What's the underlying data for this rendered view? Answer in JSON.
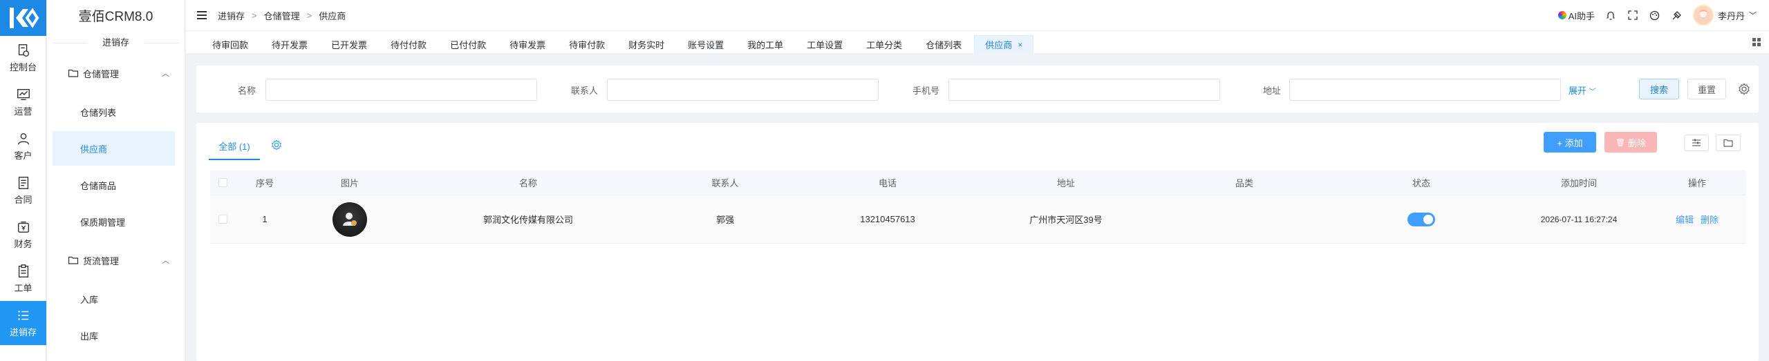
{
  "rail": [
    {
      "label": "控制台",
      "icon": "dashboard-icon"
    },
    {
      "label": "运营",
      "icon": "chart-monitor-icon"
    },
    {
      "label": "客户",
      "icon": "user-icon"
    },
    {
      "label": "合同",
      "icon": "contract-icon"
    },
    {
      "label": "财务",
      "icon": "finance-icon"
    },
    {
      "label": "工单",
      "icon": "ticket-icon"
    },
    {
      "label": "进销存",
      "icon": "list-icon"
    }
  ],
  "sidebar": {
    "brand": "壹佰CRM8.0",
    "section": "进销存",
    "groups": [
      {
        "label": "仓储管理",
        "items": [
          "仓储列表",
          "供应商",
          "仓储商品",
          "保质期管理"
        ]
      },
      {
        "label": "货流管理",
        "items": [
          "入库",
          "出库"
        ]
      }
    ],
    "active_item": "供应商"
  },
  "header": {
    "breadcrumb": [
      "进销存",
      "仓储管理",
      "供应商"
    ],
    "ai_label": "AI助手",
    "user_name": "李丹丹"
  },
  "tabs": [
    "待审回款",
    "待开发票",
    "已开发票",
    "待付付款",
    "已付付款",
    "待审发票",
    "待审付款",
    "财务实时",
    "账号设置",
    "我的工单",
    "工单设置",
    "工单分类",
    "仓储列表",
    "供应商"
  ],
  "filter": {
    "name_label": "名称",
    "contact_label": "联系人",
    "phone_label": "手机号",
    "address_label": "地址",
    "expand_label": "展开",
    "search_label": "搜索",
    "reset_label": "重置"
  },
  "list": {
    "tab_label": "全部 (1)",
    "add_label": "+ 添加",
    "delete_label": "删除",
    "columns": [
      "序号",
      "图片",
      "名称",
      "联系人",
      "电话",
      "地址",
      "品类",
      "状态",
      "添加时间",
      "操作"
    ],
    "rows": [
      {
        "index": "1",
        "name": "郭润文化传媒有限公司",
        "contact": "郭强",
        "phone": "13210457613",
        "address": "广州市天河区39号",
        "category": "",
        "status_on": true,
        "added": "2026-07-11 16:27:24",
        "edit": "编辑",
        "delete": "删除"
      }
    ]
  },
  "colors": {
    "primary": "#1e88e5",
    "danger_light": "#fab6b6",
    "bg": "#f0f2f5"
  }
}
